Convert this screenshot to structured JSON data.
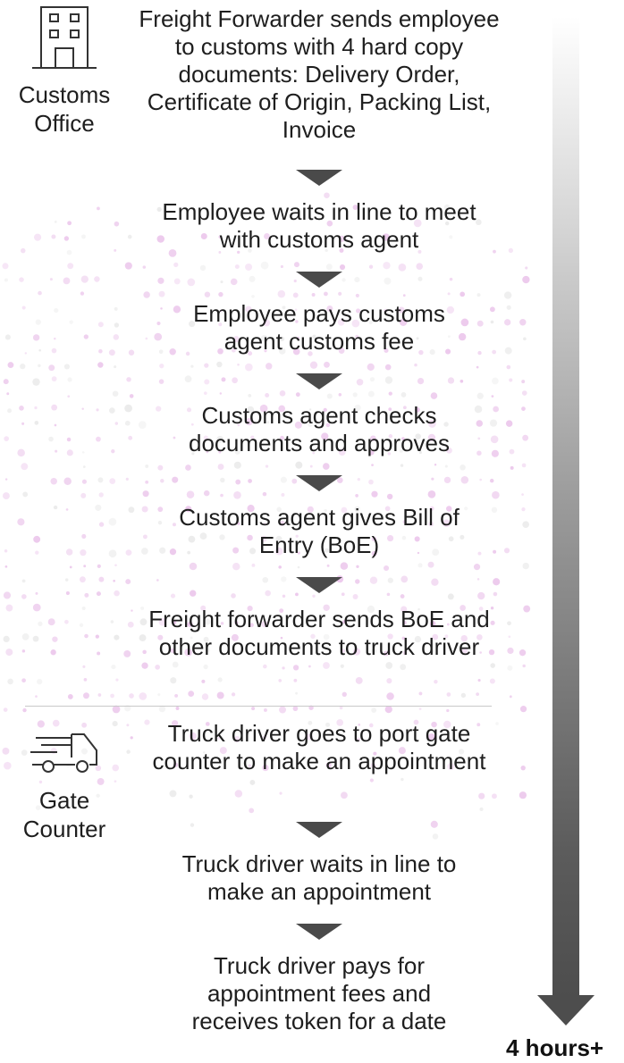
{
  "colors": {
    "accent_dots": "#e8bde8",
    "arrow": "#4a4a4a",
    "timeline": "#4d4d4d"
  },
  "locations": [
    {
      "name": "Customs\nOffice",
      "icon": "building-icon"
    },
    {
      "name": "Gate\nCounter",
      "icon": "truck-icon"
    }
  ],
  "steps": [
    "Freight Forwarder sends employee to customs with 4 hard copy documents: Delivery Order, Certificate of Origin, Packing List, Invoice",
    "Employee waits in line to meet with customs agent",
    "Employee pays customs agent customs fee",
    "Customs agent checks documents and approves",
    "Customs agent gives Bill of Entry (BoE)",
    "Freight forwarder sends BoE and other documents to truck driver",
    "Truck driver goes to port gate counter to make an appointment",
    "Truck driver waits in line to make an appointment",
    "Truck driver pays for appointment fees and receives token for a date"
  ],
  "timeline": {
    "duration_label": "4 hours+"
  }
}
